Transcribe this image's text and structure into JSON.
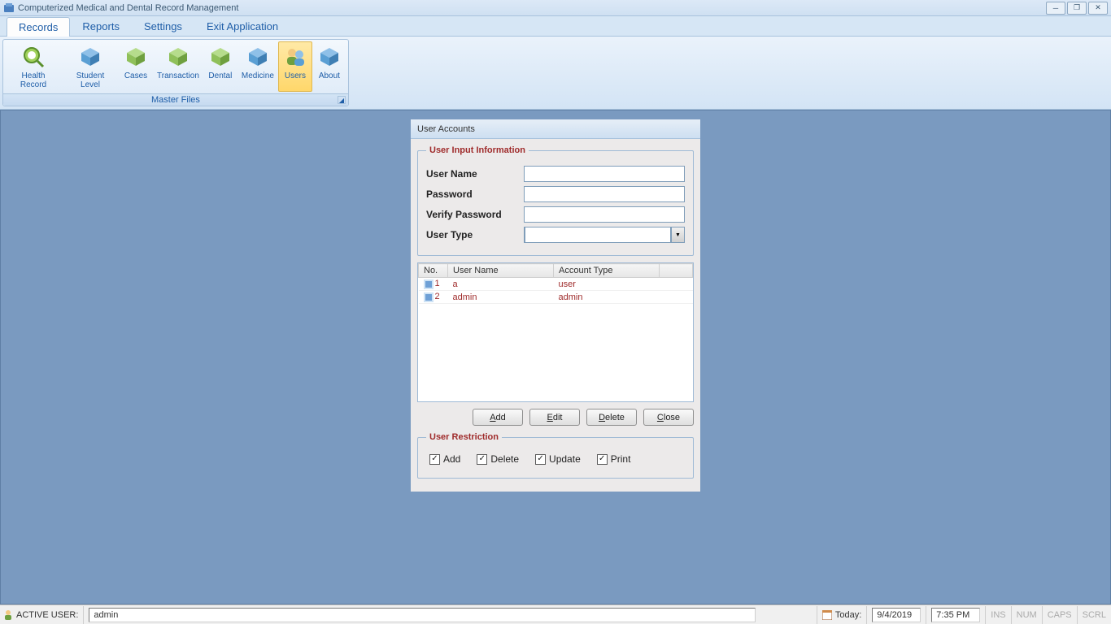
{
  "title": "Computerized Medical and Dental Record Management",
  "menu": {
    "records": "Records",
    "reports": "Reports",
    "settings": "Settings",
    "exit": "Exit Application"
  },
  "ribbon": {
    "caption": "Master Files",
    "items": [
      {
        "label": "Health Record"
      },
      {
        "label": "Student Level"
      },
      {
        "label": "Cases"
      },
      {
        "label": "Transaction"
      },
      {
        "label": "Dental"
      },
      {
        "label": "Medicine"
      },
      {
        "label": "Users"
      },
      {
        "label": "About"
      }
    ]
  },
  "panel": {
    "title": "User Accounts",
    "fieldset1": "User Input Information",
    "labels": {
      "username": "User Name",
      "password": "Password",
      "verify": "Verify Password",
      "usertype": "User Type"
    },
    "grid": {
      "headers": {
        "no": "No.",
        "user": "User Name",
        "type": "Account Type"
      },
      "rows": [
        {
          "no": "1",
          "user": "a",
          "type": "user"
        },
        {
          "no": "2",
          "user": "admin",
          "type": "admin"
        }
      ]
    },
    "buttons": {
      "add": "Add",
      "edit": "Edit",
      "delete": "Delete",
      "close": "Close"
    },
    "underline": {
      "add": "A",
      "edit": "E",
      "delete": "D",
      "close": "C"
    },
    "fieldset2": "User Restriction",
    "restrictions": {
      "add": "Add",
      "delete": "Delete",
      "update": "Update",
      "print": "Print"
    }
  },
  "status": {
    "active_label": "ACTIVE USER:",
    "active_user": "admin",
    "today_label": "Today:",
    "date": "9/4/2019",
    "time": "7:35 PM",
    "ins": "INS",
    "num": "NUM",
    "caps": "CAPS",
    "scrl": "SCRL"
  }
}
